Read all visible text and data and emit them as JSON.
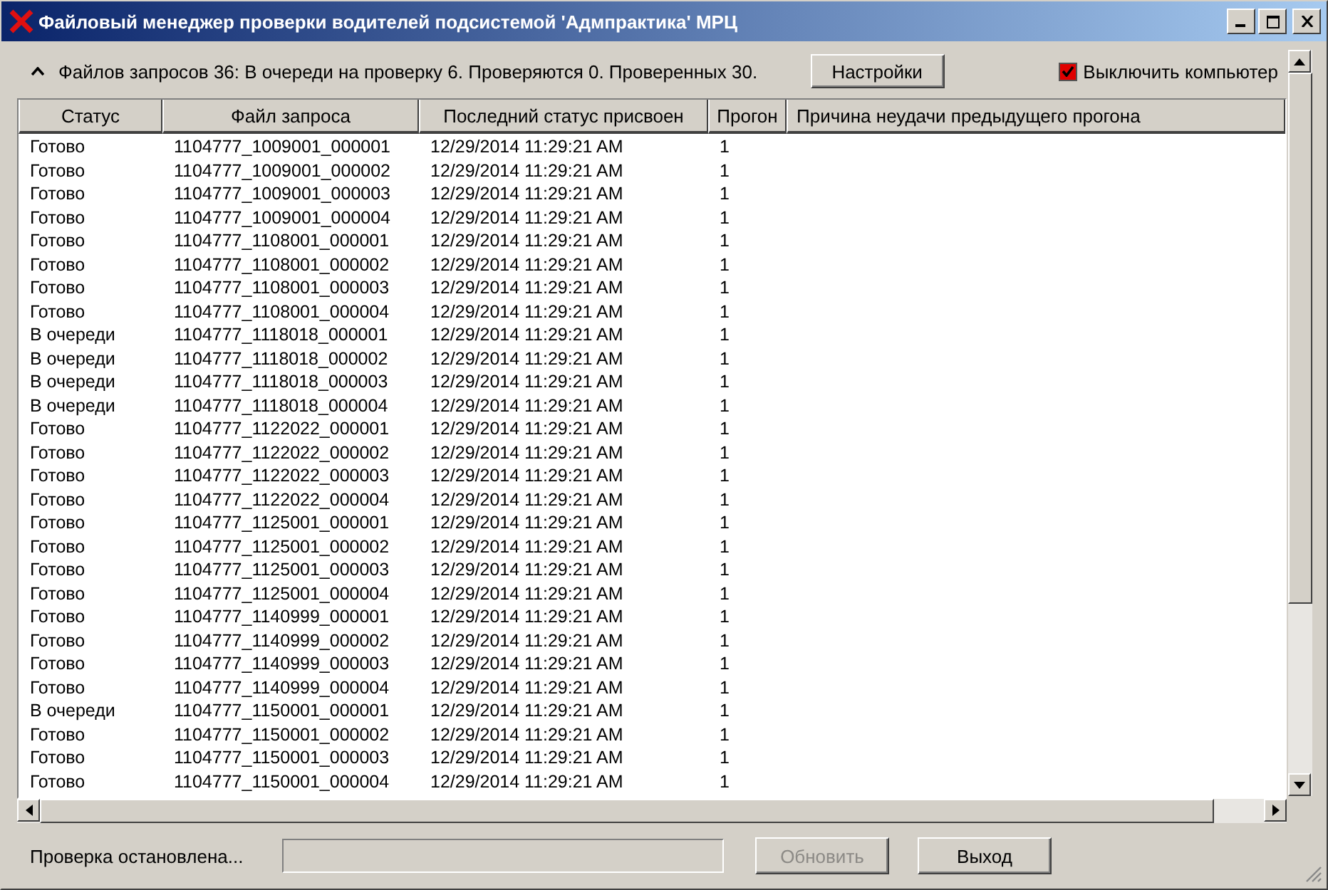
{
  "window": {
    "title": "Файловый менеджер проверки водителей подсистемой 'Адмпрактика' МРЦ"
  },
  "summary": {
    "expanded": true,
    "text": "Файлов запросов 36: В очереди на проверку 6. Проверяются 0. Проверенных 30."
  },
  "settings_button": {
    "label": "Настройки"
  },
  "shutdown_checkbox": {
    "label": "Выключить компьютер",
    "checked": true
  },
  "table": {
    "columns": [
      "Статус",
      "Файл запроса",
      "Последний статус присвоен",
      "Прогон",
      "Причина неудачи предыдущего прогона"
    ],
    "rows": [
      [
        "Готово",
        "1104777_1009001_000001",
        "12/29/2014 11:29:21 AM",
        "1"
      ],
      [
        "Готово",
        "1104777_1009001_000002",
        "12/29/2014 11:29:21 AM",
        "1"
      ],
      [
        "Готово",
        "1104777_1009001_000003",
        "12/29/2014 11:29:21 AM",
        "1"
      ],
      [
        "Готово",
        "1104777_1009001_000004",
        "12/29/2014 11:29:21 AM",
        "1"
      ],
      [
        "Готово",
        "1104777_1108001_000001",
        "12/29/2014 11:29:21 AM",
        "1"
      ],
      [
        "Готово",
        "1104777_1108001_000002",
        "12/29/2014 11:29:21 AM",
        "1"
      ],
      [
        "Готово",
        "1104777_1108001_000003",
        "12/29/2014 11:29:21 AM",
        "1"
      ],
      [
        "Готово",
        "1104777_1108001_000004",
        "12/29/2014 11:29:21 AM",
        "1"
      ],
      [
        "В очереди",
        "1104777_1118018_000001",
        "12/29/2014 11:29:21 AM",
        "1"
      ],
      [
        "В очереди",
        "1104777_1118018_000002",
        "12/29/2014 11:29:21 AM",
        "1"
      ],
      [
        "В очереди",
        "1104777_1118018_000003",
        "12/29/2014 11:29:21 AM",
        "1"
      ],
      [
        "В очереди",
        "1104777_1118018_000004",
        "12/29/2014 11:29:21 AM",
        "1"
      ],
      [
        "Готово",
        "1104777_1122022_000001",
        "12/29/2014 11:29:21 AM",
        "1"
      ],
      [
        "Готово",
        "1104777_1122022_000002",
        "12/29/2014 11:29:21 AM",
        "1"
      ],
      [
        "Готово",
        "1104777_1122022_000003",
        "12/29/2014 11:29:21 AM",
        "1"
      ],
      [
        "Готово",
        "1104777_1122022_000004",
        "12/29/2014 11:29:21 AM",
        "1"
      ],
      [
        "Готово",
        "1104777_1125001_000001",
        "12/29/2014 11:29:21 AM",
        "1"
      ],
      [
        "Готово",
        "1104777_1125001_000002",
        "12/29/2014 11:29:21 AM",
        "1"
      ],
      [
        "Готово",
        "1104777_1125001_000003",
        "12/29/2014 11:29:21 AM",
        "1"
      ],
      [
        "Готово",
        "1104777_1125001_000004",
        "12/29/2014 11:29:21 AM",
        "1"
      ],
      [
        "Готово",
        "1104777_1140999_000001",
        "12/29/2014 11:29:21 AM",
        "1"
      ],
      [
        "Готово",
        "1104777_1140999_000002",
        "12/29/2014 11:29:21 AM",
        "1"
      ],
      [
        "Готово",
        "1104777_1140999_000003",
        "12/29/2014 11:29:21 AM",
        "1"
      ],
      [
        "Готово",
        "1104777_1140999_000004",
        "12/29/2014 11:29:21 AM",
        "1"
      ],
      [
        "В очереди",
        "1104777_1150001_000001",
        "12/29/2014 11:29:21 AM",
        "1"
      ],
      [
        "Готово",
        "1104777_1150001_000002",
        "12/29/2014 11:29:21 AM",
        "1"
      ],
      [
        "Готово",
        "1104777_1150001_000003",
        "12/29/2014 11:29:21 AM",
        "1"
      ],
      [
        "Готово",
        "1104777_1150001_000004",
        "12/29/2014 11:29:21 AM",
        "1"
      ]
    ]
  },
  "status_bar": {
    "text": "Проверка остановлена...",
    "progress": {
      "level": 0
    },
    "buttons": [
      {
        "label": "Обновить",
        "disabled": true
      },
      {
        "label": "Выход",
        "disabled": false
      }
    ]
  }
}
